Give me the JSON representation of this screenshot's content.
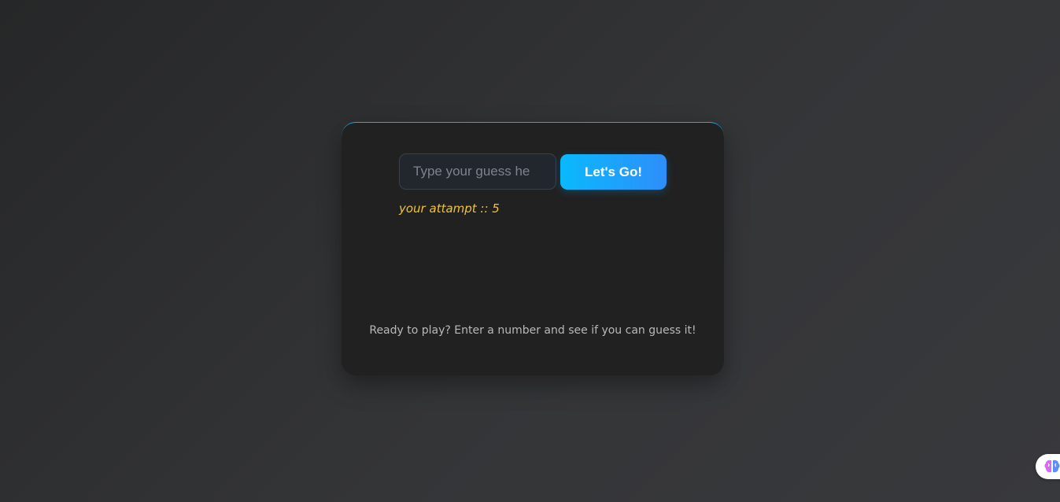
{
  "game": {
    "input_placeholder": "Type your guess he",
    "input_value": "",
    "button_label": "Let's Go!",
    "attempt_text": "your attampt :: 5",
    "status_text": "Ready to play? Enter a number and see if you can guess it!"
  },
  "extension": {
    "icon": "brain-icon"
  },
  "colors": {
    "accent": "#0ab9fd",
    "accent_end": "#2e8ef9",
    "attempt_text": "#f1c232",
    "card_background": "#212121"
  }
}
